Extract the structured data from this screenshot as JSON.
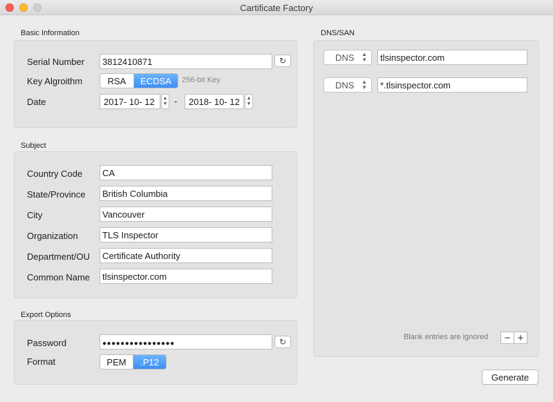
{
  "window": {
    "title": "Cartificate Factory"
  },
  "basic": {
    "section_label": "Basic Information",
    "serial_label": "Serial Number",
    "serial_value": "3812410871",
    "key_label": "Key Algroithm",
    "key_options": [
      "RSA",
      "ECDSA"
    ],
    "key_selected": "ECDSA",
    "key_hint": "256-bit Key",
    "date_label": "Date",
    "date_start": "2017- 10- 12",
    "date_sep": "-",
    "date_end": "2018- 10- 12"
  },
  "subject": {
    "section_label": "Subject",
    "fields": [
      {
        "label": "Country Code",
        "value": "CA"
      },
      {
        "label": "State/Province",
        "value": "British Columbia"
      },
      {
        "label": "City",
        "value": "Vancouver"
      },
      {
        "label": "Organization",
        "value": "TLS Inspector"
      },
      {
        "label": "Department/OU",
        "value": "Certificate Authority"
      },
      {
        "label": "Common Name",
        "value": "tlsinspector.com"
      }
    ]
  },
  "export": {
    "section_label": "Export Options",
    "password_label": "Password",
    "password_value": "●●●●●●●●●●●●●●●●",
    "format_label": "Format",
    "format_options": [
      "PEM",
      ".P12"
    ],
    "format_selected": ".P12"
  },
  "dns": {
    "section_label": "DNS/SAN",
    "entries": [
      {
        "type": "DNS",
        "value": "tlsinspector.com"
      },
      {
        "type": "DNS",
        "value": "*.tlsinspector.com"
      }
    ],
    "blank_hint": "Blank entries are ignored",
    "remove_symbol": "−",
    "add_symbol": "+"
  },
  "actions": {
    "generate_label": "Generate"
  },
  "icons": {
    "refresh": "refresh-icon",
    "stepper": "stepper-icon",
    "popup_chevron": "chevron-updown-icon"
  },
  "colors": {
    "accent": "#3f8ef5",
    "close": "#fc5f57",
    "minimize": "#fdbc2e",
    "zoom": "#d0d0d0",
    "window_bg": "#ececec"
  }
}
